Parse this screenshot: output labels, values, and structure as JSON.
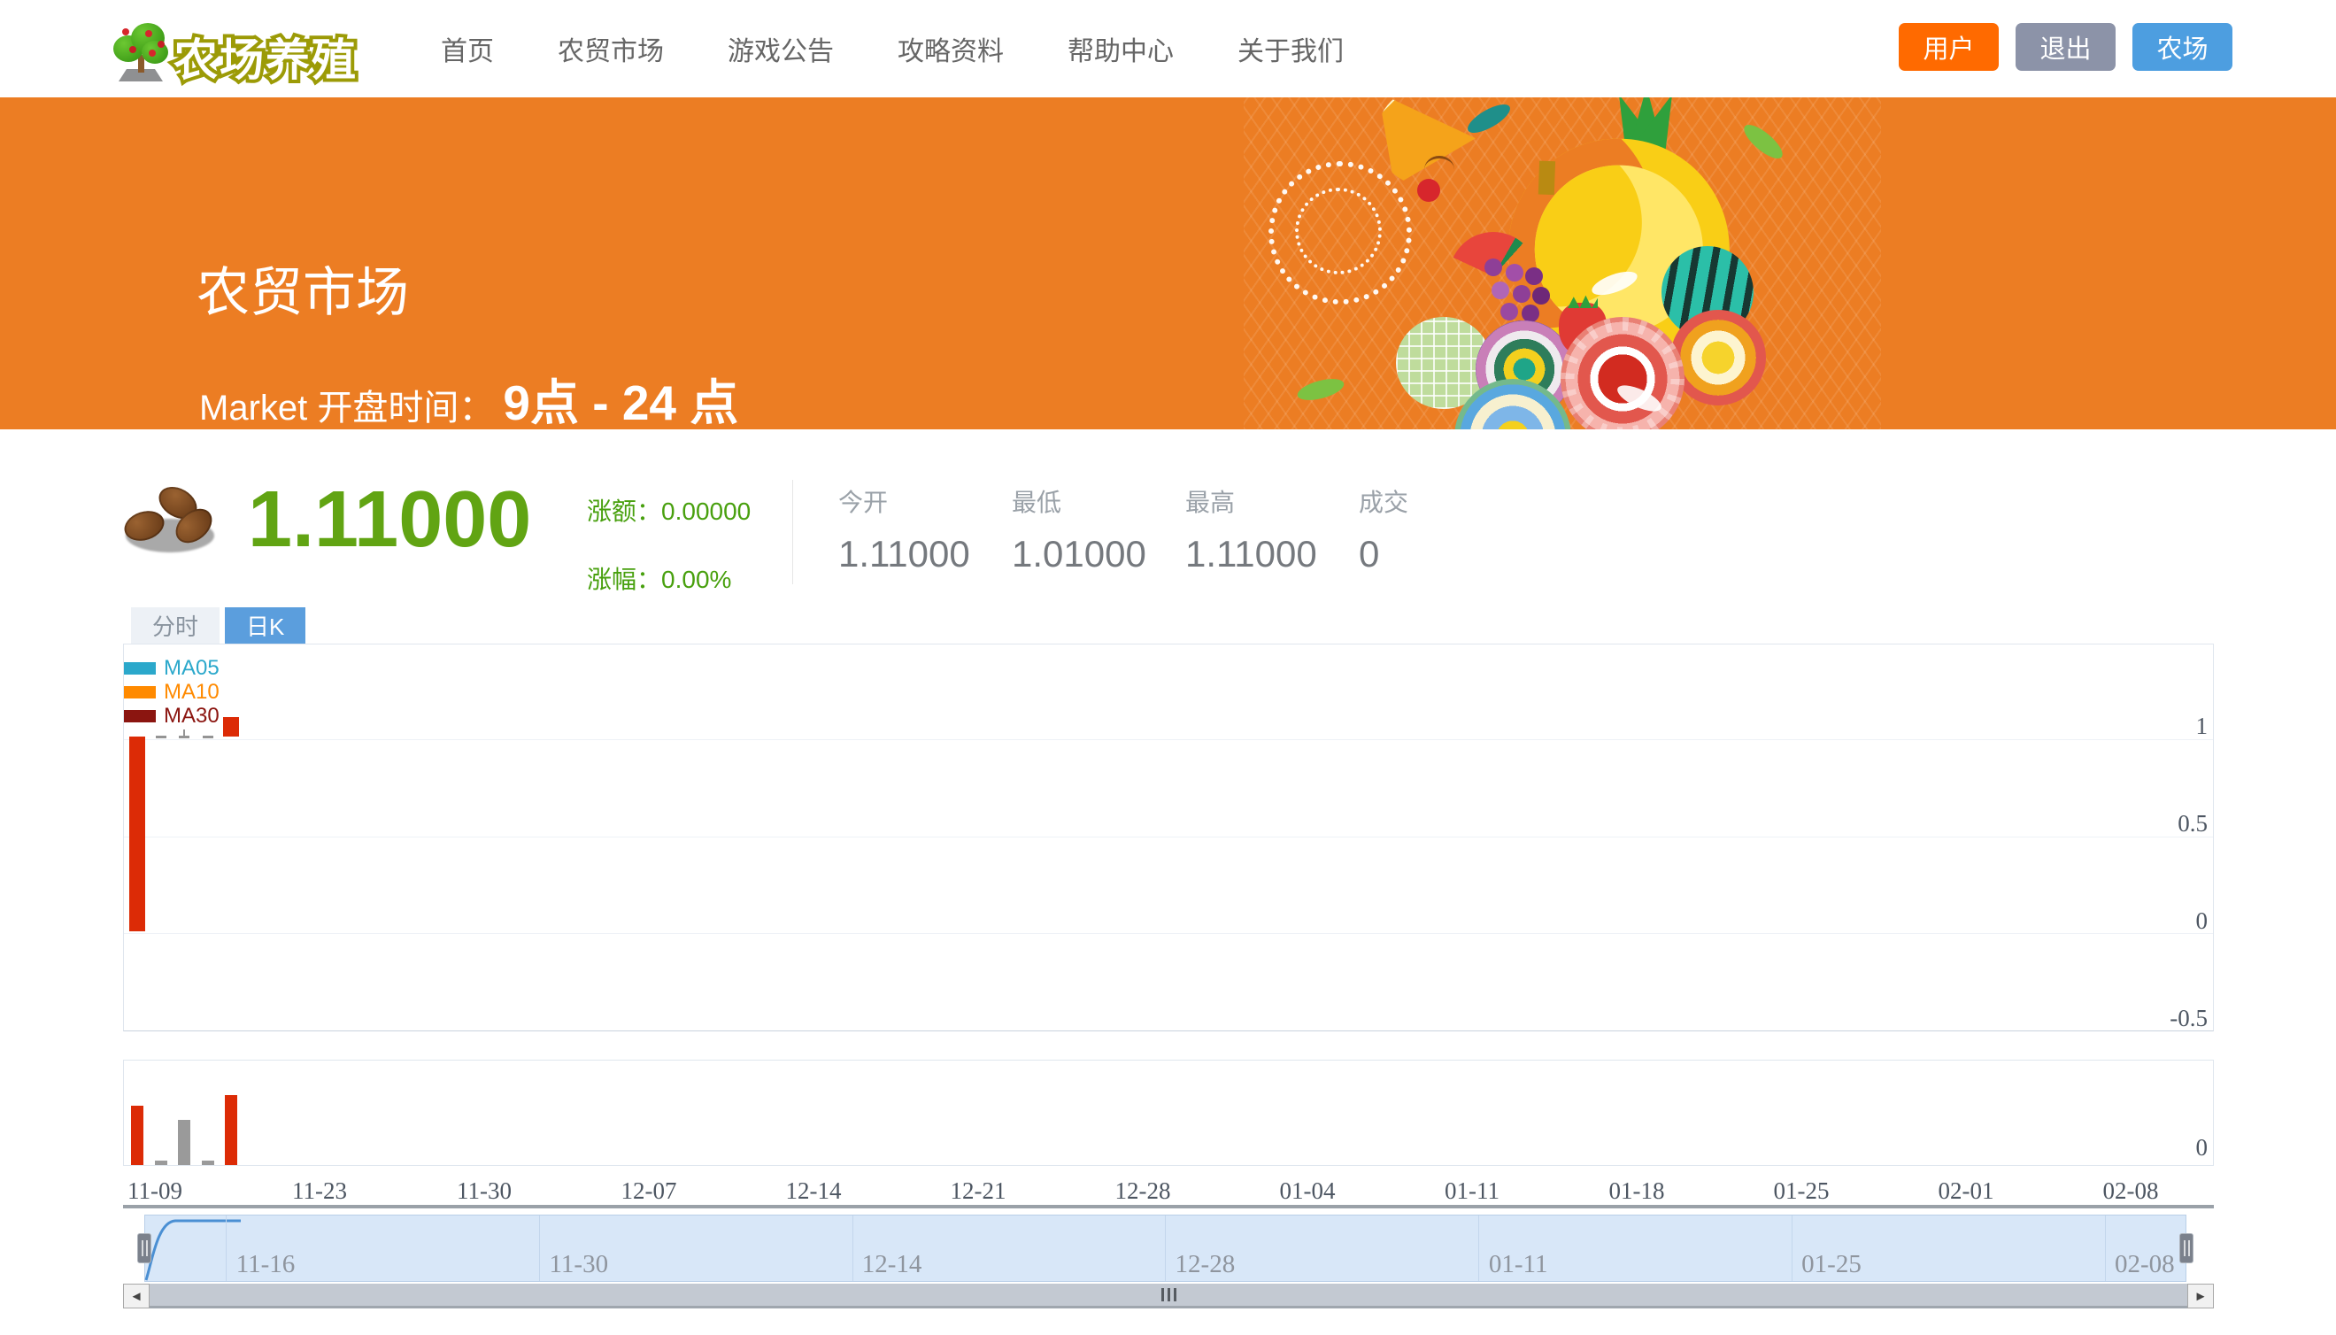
{
  "header": {
    "logo_text": "农场养殖",
    "nav_items": [
      {
        "id": "home",
        "label": "首页"
      },
      {
        "id": "market",
        "label": "农贸市场"
      },
      {
        "id": "announcements",
        "label": "游戏公告"
      },
      {
        "id": "guides",
        "label": "攻略资料"
      },
      {
        "id": "help",
        "label": "帮助中心"
      },
      {
        "id": "about",
        "label": "关于我们"
      }
    ],
    "buttons": [
      {
        "id": "user",
        "label": "用户",
        "color": "#ff6a00"
      },
      {
        "id": "logout",
        "label": "退出",
        "color": "#8c93a8"
      },
      {
        "id": "farm",
        "label": "农场",
        "color": "#4d9ee0"
      }
    ]
  },
  "hero": {
    "title": "农贸市场",
    "subtitle_prefix": "Market 开盘时间：",
    "subtitle_time": "9点 - 24 点"
  },
  "quote": {
    "price": "1.11000",
    "price_color": "#61a413",
    "change_label": "涨额：",
    "change_value": "0.00000",
    "change_pct_label": "涨幅：",
    "change_pct_value": "0.00%",
    "stats": [
      {
        "label": "今开",
        "value": "1.11000"
      },
      {
        "label": "最低",
        "value": "1.01000"
      },
      {
        "label": "最高",
        "value": "1.11000"
      },
      {
        "label": "成交",
        "value": "0"
      }
    ]
  },
  "tabs": [
    {
      "id": "minute",
      "label": "分时",
      "active": false
    },
    {
      "id": "daily-k",
      "label": "日K",
      "active": true
    }
  ],
  "chart_data": {
    "type": "candlestick",
    "legend": [
      {
        "name": "MA05",
        "color": "#2ba8cb"
      },
      {
        "name": "MA10",
        "color": "#ff8a00"
      },
      {
        "name": "MA30",
        "color": "#8b1510"
      }
    ],
    "legend_position": "top-left",
    "grid": true,
    "up_color": "#dc2b06",
    "flat_color": "#949494",
    "y_axis": {
      "position": "right",
      "ticks": [
        "1",
        "0.5",
        "0",
        "-0.5"
      ],
      "lim": [
        -0.5,
        1.5
      ]
    },
    "x_axis": {
      "ticks": [
        "11-09",
        "11-23",
        "11-30",
        "12-07",
        "12-14",
        "12-21",
        "12-28",
        "01-04",
        "01-11",
        "01-18",
        "01-25",
        "02-01",
        "02-08"
      ]
    },
    "candles": [
      {
        "day": 0,
        "open": 0.01,
        "close": 1.01,
        "low": 0.01,
        "high": 1.01,
        "direction": "up"
      },
      {
        "day": 1,
        "open": 1.01,
        "close": 1.01,
        "low": 1.01,
        "high": 1.01,
        "direction": "flat"
      },
      {
        "day": 2,
        "open": 1.01,
        "close": 1.01,
        "low": 1.01,
        "high": 1.05,
        "direction": "flat"
      },
      {
        "day": 3,
        "open": 1.01,
        "close": 1.01,
        "low": 1.01,
        "high": 1.01,
        "direction": "flat"
      },
      {
        "day": 4,
        "open": 1.01,
        "close": 1.11,
        "low": 1.01,
        "high": 1.11,
        "direction": "up"
      }
    ],
    "volume": {
      "y_ticks": [
        "0"
      ],
      "bars": [
        {
          "rel": 0.57,
          "direction": "up"
        },
        {
          "rel": 0.04,
          "direction": "flat"
        },
        {
          "rel": 0.43,
          "direction": "flat"
        },
        {
          "rel": 0.04,
          "direction": "flat"
        },
        {
          "rel": 0.67,
          "direction": "up"
        }
      ]
    }
  },
  "datazoom": {
    "labels": [
      "11-16",
      "11-30",
      "12-14",
      "12-28",
      "01-11",
      "01-25",
      "02-08"
    ]
  },
  "scrollbar": {
    "left_arrow": "◄",
    "right_arrow": "►",
    "grip": "|||"
  }
}
